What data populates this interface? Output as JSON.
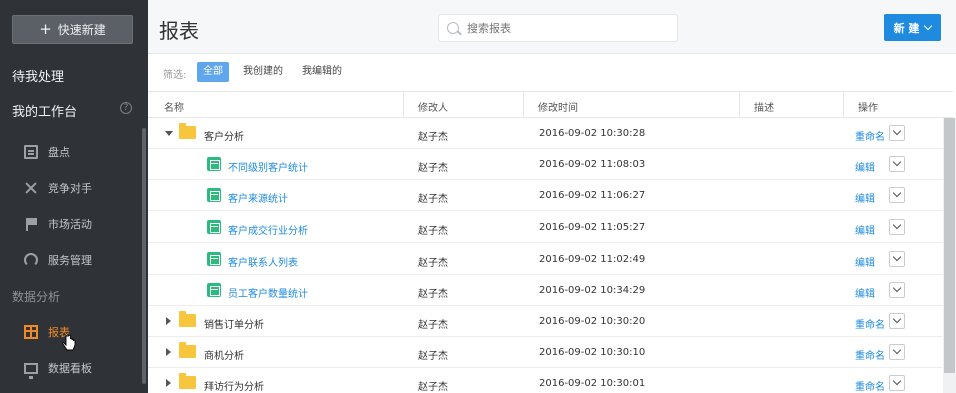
{
  "sidebar": {
    "quick_new": {
      "icon": "plus-icon",
      "label": "快速新建"
    },
    "pending": "待我处理",
    "workspace": "我的工作台",
    "help_glyph": "?",
    "items": [
      {
        "label": "盘点",
        "icon": "clipboard-icon"
      },
      {
        "label": "竞争对手",
        "icon": "crossed-tools-icon"
      },
      {
        "label": "市场活动",
        "icon": "flag-icon"
      },
      {
        "label": "服务管理",
        "icon": "headset-icon"
      }
    ],
    "group_label": "数据分析",
    "group_items": [
      {
        "label": "报表",
        "icon": "table-icon",
        "active": true
      },
      {
        "label": "数据看板",
        "icon": "board-icon"
      }
    ],
    "active_color": "#f08a24"
  },
  "header": {
    "title": "报表",
    "search_placeholder": "搜索报表",
    "new_button": "新 建"
  },
  "filter": {
    "label": "筛选:",
    "options": [
      "全部",
      "我创建的",
      "我编辑的"
    ],
    "selected": "全部"
  },
  "table": {
    "columns": [
      "名称",
      "修改人",
      "修改时间",
      "描述",
      "操作"
    ],
    "rows": [
      {
        "type": "folder",
        "expanded": true,
        "name": "客户分析",
        "modifier": "赵子杰",
        "time": "2016-09-02 10:30:28",
        "action": "重命名"
      },
      {
        "type": "report",
        "name": "不同级别客户统计",
        "modifier": "赵子杰",
        "time": "2016-09-02 11:08:03",
        "action": "编辑"
      },
      {
        "type": "report",
        "name": "客户来源统计",
        "modifier": "赵子杰",
        "time": "2016-09-02 11:06:27",
        "action": "编辑"
      },
      {
        "type": "report",
        "name": "客户成交行业分析",
        "modifier": "赵子杰",
        "time": "2016-09-02 11:05:27",
        "action": "编辑"
      },
      {
        "type": "report",
        "name": "客户联系人列表",
        "modifier": "赵子杰",
        "time": "2016-09-02 11:02:49",
        "action": "编辑"
      },
      {
        "type": "report",
        "name": "员工客户数量统计",
        "modifier": "赵子杰",
        "time": "2016-09-02 10:34:29",
        "action": "编辑"
      },
      {
        "type": "folder",
        "expanded": false,
        "name": "销售订单分析",
        "modifier": "赵子杰",
        "time": "2016-09-02 10:30:20",
        "action": "重命名"
      },
      {
        "type": "folder",
        "expanded": false,
        "name": "商机分析",
        "modifier": "赵子杰",
        "time": "2016-09-02 10:30:10",
        "action": "重命名"
      },
      {
        "type": "folder",
        "expanded": false,
        "name": "拜访行为分析",
        "modifier": "赵子杰",
        "time": "2016-09-02 10:30:01",
        "action": "重命名"
      }
    ]
  },
  "colors": {
    "accent": "#1e8ae0",
    "folder": "#f7c63d",
    "report_icon": "#2bbb7f",
    "sidebar_bg": "#2f3338"
  }
}
